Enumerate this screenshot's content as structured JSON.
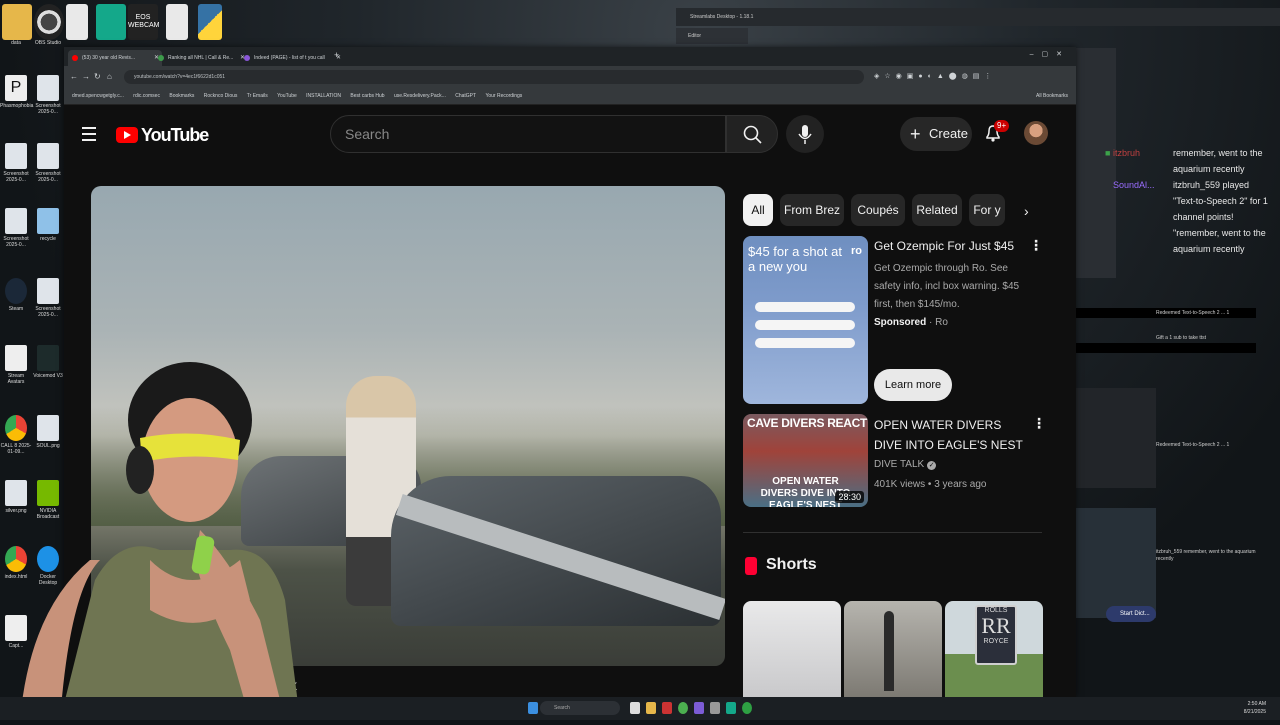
{
  "desktop": {
    "top_icons": [
      "EOS WEBCAM"
    ],
    "icons": [
      {
        "label": "data"
      },
      {
        "label": "OBS Studio"
      },
      {
        "label": "Phasmophobia"
      },
      {
        "label": "Screenshot 2025-0..."
      },
      {
        "label": "Screenshot 2025-0..."
      },
      {
        "label": "Screenshot 2025-0..."
      },
      {
        "label": "Screenshot 2025-0..."
      },
      {
        "label": "recycle"
      },
      {
        "label": "Steam"
      },
      {
        "label": "Screenshot 2025-0..."
      },
      {
        "label": "Stream Avatars"
      },
      {
        "label": "Voicemod V3"
      },
      {
        "label": "CALL 8 2025-01-09..."
      },
      {
        "label": "SOUL.png"
      },
      {
        "label": "silver.png"
      },
      {
        "label": "NVIDIA Broadcast"
      },
      {
        "label": "index.html"
      },
      {
        "label": "Docker Desktop"
      },
      {
        "label": "Capt..."
      }
    ]
  },
  "browser": {
    "tabs": [
      {
        "label": "(53) 30 year old Revis...",
        "color": "#ff0000"
      },
      {
        "label": "Ranking all NHL | Call & Re...",
        "color": "#3c9a4a"
      },
      {
        "label": "Indeed (PAGE) - list of t you call",
        "color": "#8a57d8"
      }
    ],
    "url": "youtube.com/watch?v=4ec1f6622d1c051",
    "bookmarks": [
      "dmed.spencwgetgly.c...",
      "rdic.comsec",
      "Bookmarks",
      "Rocknco Dious",
      "Tr Emails",
      "YouTube",
      "INSTALLATION",
      "Best carbs Hub",
      "use.Resdelivery.Pack...",
      "ChatGPT",
      "Your Recordings"
    ],
    "bookmarks_right": "All Bookmarks"
  },
  "youtube": {
    "logo_text": "YouTube",
    "search_placeholder": "Search",
    "create_label": "Create",
    "notif_count": "9+",
    "caption_char": "k",
    "chips": [
      "All",
      "From Brez",
      "Coupés",
      "Related",
      "For y"
    ],
    "ad": {
      "thumb_headline": "$45 for a shot at a new you",
      "thumb_brand": "ro",
      "title": "Get Ozempic For Just $45",
      "description": "Get Ozempic through Ro. See safety info, incl box warning. $45 first, then $145/mo.",
      "sponsored": "Sponsored",
      "advertiser": "Ro",
      "cta": "Learn more"
    },
    "video": {
      "thumb_top": "CAVE DIVERS REACT",
      "thumb_bottom": "OPEN WATER DIVERS DIVE INTO EAGLE'S NEST",
      "duration": "28:30",
      "title": "OPEN WATER DIVERS DIVE INTO EAGLE'S NEST",
      "channel": "DIVE TALK",
      "meta": "401K views • 3 years ago"
    },
    "shorts_label": "Shorts",
    "shorts_thumb_text": [
      "ROLLS",
      "RR",
      "ROYCE"
    ]
  },
  "obs": {
    "title": "Streamlabs Desktop - 1.18.1",
    "editor_label": "Editor"
  },
  "chat": {
    "lines": [
      {
        "user": "itzbruh",
        "text": "remember, went to the aquarium recently"
      },
      {
        "user": "SoundAl...",
        "text": "itzbruh_559 played \"Text-to-Speech 2\" for 1 channel points! \"remember, went to the aquarium recently"
      }
    ],
    "mini_lines": [
      "Redeemed Text-to-Speech 2 ... 1",
      "Gift a 1 sub to take ttst",
      "Redeemed Text-to-Speech 2 ... 1",
      "itzbruh_559 remember, went to the aquarium recently"
    ],
    "dictation_label": "Start Dict..."
  },
  "taskbar": {
    "search_label": "Search",
    "time": "2:50 AM",
    "date": "8/21/2025"
  }
}
